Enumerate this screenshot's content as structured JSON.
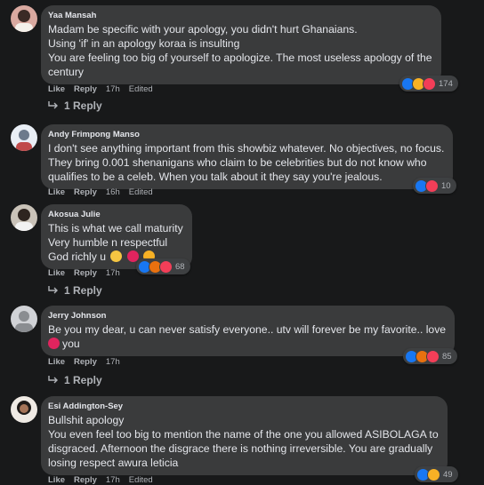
{
  "colors": {
    "background": "#18191a",
    "bubble": "#3a3b3c",
    "text": "#e4e6eb",
    "muted": "#b0b3b8",
    "like_blue": "#1877f2",
    "love_red": "#f33e58",
    "haha_yellow": "#f7b125"
  },
  "comments": [
    {
      "author": "Yaa Mansah",
      "lines": [
        "Madam be specific with your apology, you didn't hurt Ghanaians.",
        "Using 'if' in an apology koraa is insulting",
        "You are feeling too big of yourself to apologize. The most useless apology of the",
        "century"
      ],
      "like": "Like",
      "reply": "Reply",
      "time": "17h",
      "edited": "Edited",
      "reactions": [
        "like-icon",
        "haha-icon",
        "love-icon"
      ],
      "reaction_count": "174",
      "replies": "1 Reply"
    },
    {
      "author": "Andy Frimpong Manso",
      "lines": [
        "I don't see anything important from this showbiz whatever. No objectives, no focus.",
        "They bring 0.001 shenanigans who claim to be celebrities but do not know who",
        "qualifies to be a celeb. When you talk about it they say you're jealous."
      ],
      "like": "Like",
      "reply": "Reply",
      "time": "16h",
      "edited": "Edited",
      "reactions": [
        "like-icon",
        "love-icon"
      ],
      "reaction_count": "10",
      "replies": ""
    },
    {
      "author": "Akosua Julie",
      "lines": [
        "This is what we call maturity",
        "Very humble n respectful",
        "God richly u"
      ],
      "like": "Like",
      "reply": "Reply",
      "time": "17h",
      "edited": "",
      "reactions": [
        "like-icon",
        "angry-icon",
        "love-icon"
      ],
      "reaction_count": "68",
      "replies": "1 Reply"
    },
    {
      "author": "Jerry Johnson",
      "lines": [
        "Be you my dear, u can never satisfy everyone.. utv will forever be my favorite.. love",
        "you"
      ],
      "like": "Like",
      "reply": "Reply",
      "time": "17h",
      "edited": "",
      "reactions": [
        "like-icon",
        "angry-icon",
        "love-icon"
      ],
      "reaction_count": "85",
      "replies": "1 Reply"
    },
    {
      "author": "Esi Addington-Sey",
      "lines": [
        "Bullshit apology",
        "You even feel too big to mention the name of the one you allowed ASIBOLAGA to",
        "disgraced. Afternoon the disgrace there is nothing irreversible. You are gradually",
        "losing respect awura leticia"
      ],
      "like": "Like",
      "reply": "Reply",
      "time": "17h",
      "edited": "Edited",
      "reactions": [
        "like-icon",
        "haha-icon"
      ],
      "reaction_count": "49",
      "replies": ""
    }
  ]
}
